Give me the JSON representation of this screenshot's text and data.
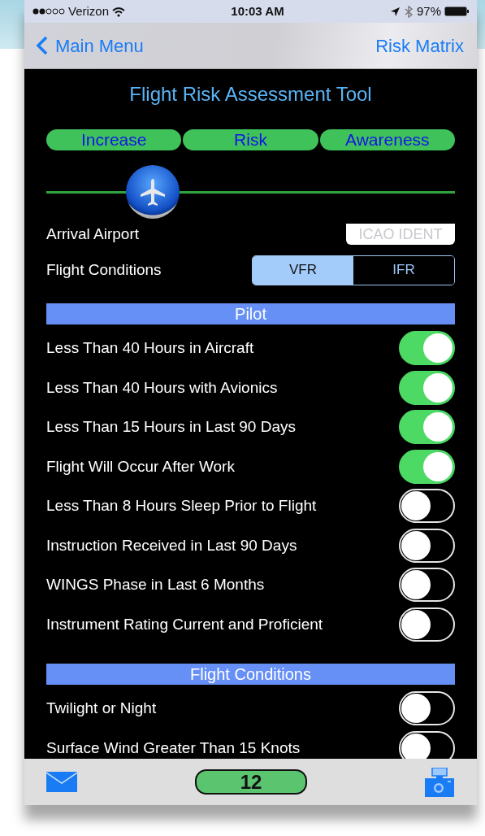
{
  "status_bar": {
    "carrier": "Verizon",
    "time": "10:03 AM",
    "battery": "97%"
  },
  "nav": {
    "back": "Main Menu",
    "right": "Risk Matrix"
  },
  "title": "Flight Risk Assessment Tool",
  "banner": [
    "Increase",
    "Risk",
    "Awareness"
  ],
  "risk_slider": {
    "level": 0.26
  },
  "arrival": {
    "label": "Arrival Airport",
    "placeholder": "ICAO IDENT"
  },
  "conditions": {
    "label": "Flight Conditions",
    "options": [
      {
        "label": "VFR",
        "selected": true
      },
      {
        "label": "IFR",
        "selected": false
      }
    ]
  },
  "sections": [
    {
      "title": "Pilot",
      "items": [
        {
          "label": "Less Than 40 Hours in Aircraft",
          "on": true
        },
        {
          "label": "Less Than 40 Hours with Avionics",
          "on": true
        },
        {
          "label": "Less Than 15 Hours in Last 90 Days",
          "on": true
        },
        {
          "label": "Flight Will Occur After Work",
          "on": true
        },
        {
          "label": "Less Than 8 Hours Sleep Prior to Flight",
          "on": false
        },
        {
          "label": "Instruction Received in Last 90 Days",
          "on": false
        },
        {
          "label": "WINGS Phase in Last 6 Months",
          "on": false
        },
        {
          "label": "Instrument Rating Current and Proficient",
          "on": false
        }
      ]
    },
    {
      "title": "Flight Conditions",
      "items": [
        {
          "label": "Twilight or Night",
          "on": false
        },
        {
          "label": "Surface Wind Greater Than 15 Knots",
          "on": false
        }
      ]
    }
  ],
  "toolbar": {
    "score": "12"
  }
}
